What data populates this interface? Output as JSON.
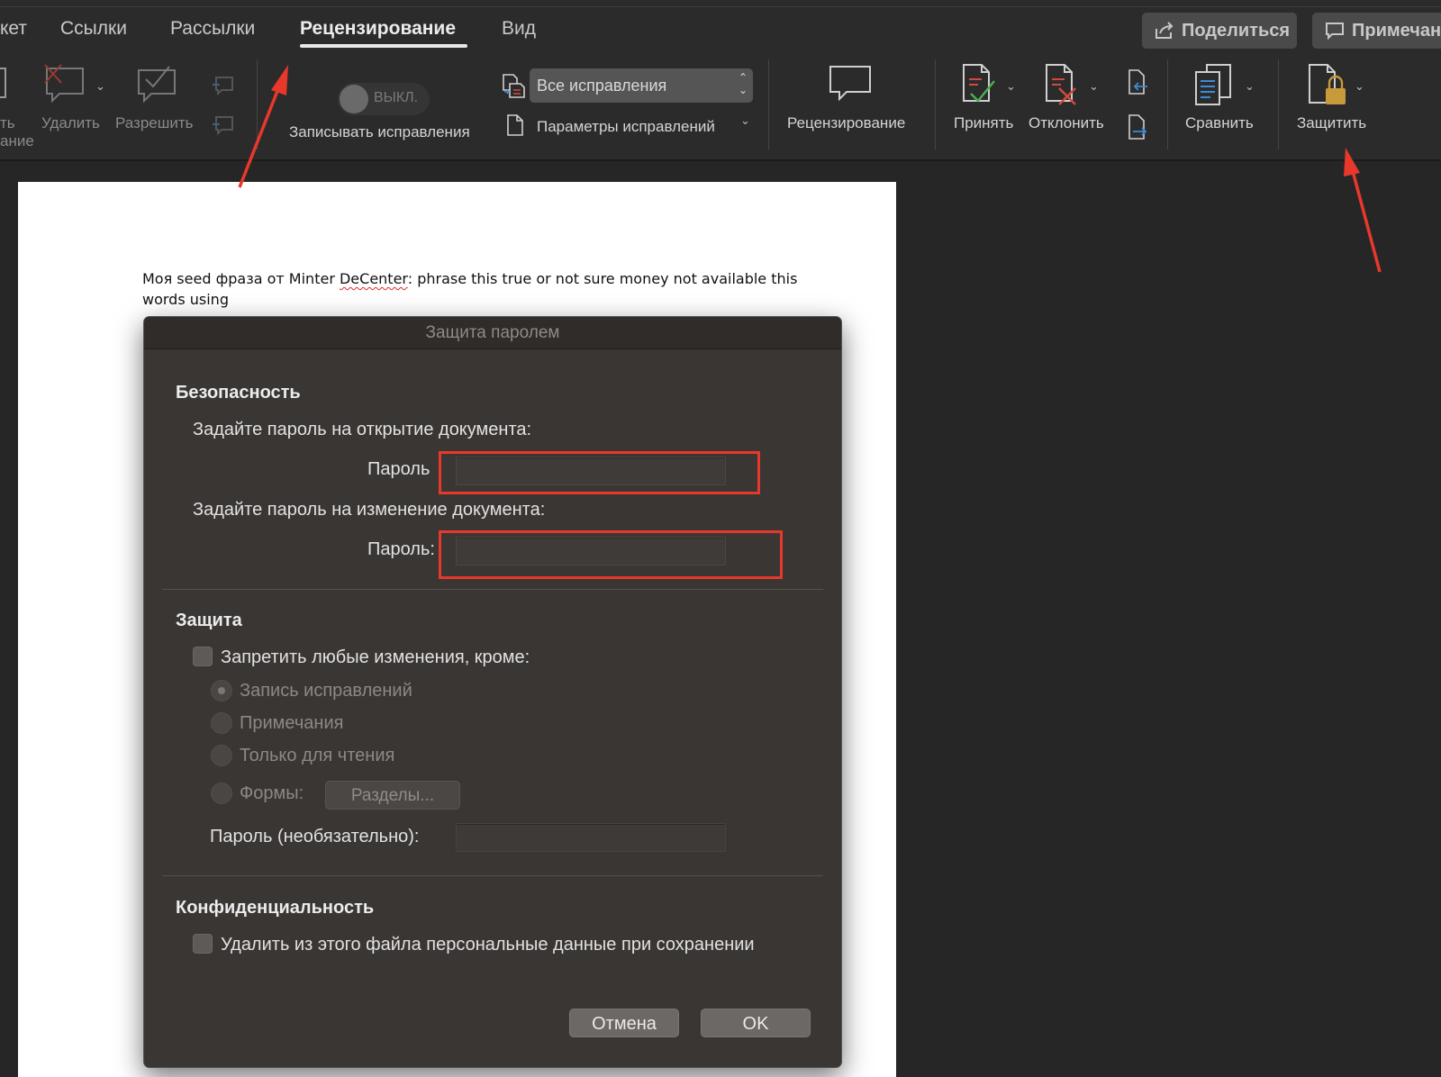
{
  "tabs": [
    {
      "label": "кет"
    },
    {
      "label": "Ссылки"
    },
    {
      "label": "Рассылки"
    },
    {
      "label": "Рецензирование",
      "active": true
    },
    {
      "label": "Вид"
    }
  ],
  "header": {
    "share_label": "Поделиться",
    "comments_label": "Примечания"
  },
  "ribbon": {
    "partial_label_1": "ть",
    "partial_label_2": "ание",
    "delete_label": "Удалить",
    "resolve_label": "Разрешить",
    "toggle_label": "ВЫКЛ.",
    "track_changes_label": "Записывать исправления",
    "markup_select_value": "Все исправления",
    "markup_options_label": "Параметры исправлений",
    "reviewing_label": "Рецензирование",
    "accept_label": "Принять",
    "reject_label": "Отклонить",
    "compare_label": "Сравнить",
    "protect_label": "Защитить"
  },
  "document": {
    "text_before": "Моя seed фраза от Minter ",
    "text_misspelled": "DeCenter",
    "text_after": ": phrase this true or not sure money not available this words using"
  },
  "dialog": {
    "title": "Защита паролем",
    "security_heading": "Безопасность",
    "open_password_prompt": "Задайте пароль на открытие документа:",
    "open_password_label": "Пароль",
    "modify_password_prompt": "Задайте пароль на изменение документа:",
    "modify_password_label": "Пароль:",
    "protection_heading": "Защита",
    "restrict_label": "Запретить любые изменения, кроме:",
    "options": [
      {
        "label": "Запись исправлений",
        "selected": true
      },
      {
        "label": "Примечания",
        "selected": false
      },
      {
        "label": "Только для чтения",
        "selected": false
      },
      {
        "label": "Формы:",
        "selected": false
      }
    ],
    "sections_button": "Разделы...",
    "optional_password_label": "Пароль (необязательно):",
    "privacy_heading": "Конфиденциальность",
    "privacy_label": "Удалить из этого файла персональные данные при сохранении",
    "cancel_label": "Отмена",
    "ok_label": "OK"
  },
  "colors": {
    "annotation": "#e8382b",
    "background": "#262626",
    "dialog": "#3a3634"
  }
}
